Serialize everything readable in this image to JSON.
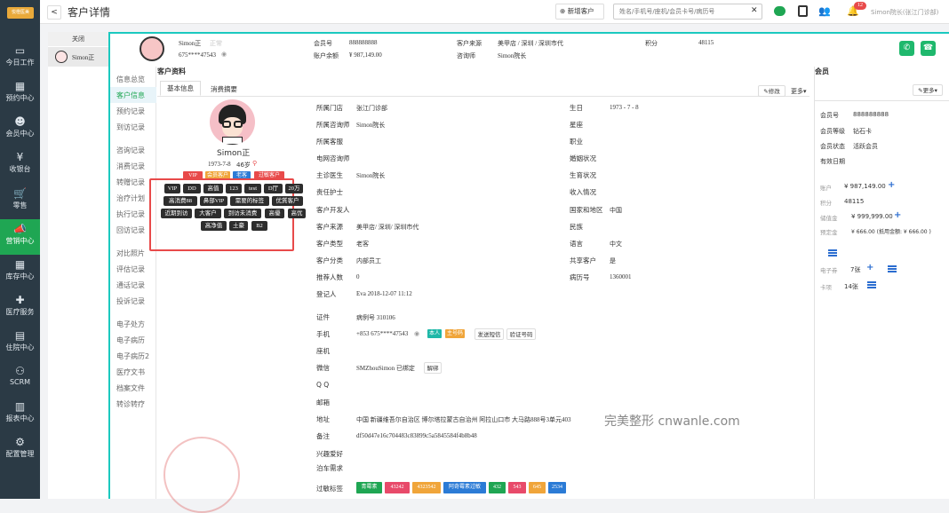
{
  "app": {
    "logo_text": "悦橙医美"
  },
  "sidenav": [
    {
      "label": "今日工作",
      "icon": "monitor-icon"
    },
    {
      "label": "预约中心",
      "icon": "calendar-icon"
    },
    {
      "label": "会员中心",
      "icon": "users-icon"
    },
    {
      "label": "收银台",
      "icon": "yen-icon"
    },
    {
      "label": "零售",
      "icon": "cart-icon"
    },
    {
      "label": "营销中心",
      "icon": "megaphone-icon"
    },
    {
      "label": "库存中心",
      "icon": "grid-icon"
    },
    {
      "label": "医疗服务",
      "icon": "medkit-icon"
    },
    {
      "label": "住院中心",
      "icon": "clipboard-icon"
    },
    {
      "label": "SCRM",
      "icon": "network-icon"
    },
    {
      "label": "报表中心",
      "icon": "chart-icon"
    },
    {
      "label": "配置管理",
      "icon": "gear-icon"
    }
  ],
  "topbar": {
    "back": "<",
    "title": "客户详情",
    "new_customer": "新增客户",
    "search_placeholder": "姓名/手机号/座机/会员卡号/病历号",
    "badge": "12",
    "user": "Simon院长(张江门诊部)"
  },
  "tabs": {
    "close": "关闭",
    "current": "Simon正"
  },
  "header": {
    "name": "Simon正",
    "name_tag": "正常",
    "phone": "675****47543",
    "member_no_label": "会员号",
    "member_no": "888888888",
    "balance_label": "账户余额",
    "balance": "¥ 987,149.00",
    "source_label": "客户来源",
    "source": "美甲店 / 深圳 / 深圳市代",
    "consultant_label": "咨询师",
    "consultant": "Simon院长",
    "points_label": "积分",
    "points": "48115"
  },
  "leftmenu": [
    {
      "label": "信息总览"
    },
    {
      "label": "客户信息"
    },
    {
      "label": "预约记录"
    },
    {
      "label": "到访记录"
    },
    {
      "label": "咨询记录"
    },
    {
      "label": "消费记录"
    },
    {
      "label": "转赠记录"
    },
    {
      "label": "治疗计划"
    },
    {
      "label": "执行记录"
    },
    {
      "label": "回访记录"
    },
    {
      "label": "对比照片"
    },
    {
      "label": "评估记录"
    },
    {
      "label": "通话记录"
    },
    {
      "label": "投诉记录"
    },
    {
      "label": "电子处方"
    },
    {
      "label": "电子病历"
    },
    {
      "label": "电子病历2"
    },
    {
      "label": "医疗文书"
    },
    {
      "label": "档案文件"
    },
    {
      "label": "转诊转疗"
    }
  ],
  "profile": {
    "section_title": "客户资料",
    "tab_basic": "基本信息",
    "tab_consume": "消费摘要",
    "edit": "修改",
    "more": "更多",
    "name": "Simon正",
    "birth": "1973-7-8",
    "age": "46岁",
    "status_tags": [
      {
        "text": "VIP",
        "color": "#e84a4a"
      },
      {
        "text": "会员客户",
        "color": "#f0a53a"
      },
      {
        "text": "老客",
        "color": "#2b7bd6"
      },
      {
        "text": "过敏客户",
        "color": "#e84a4a"
      }
    ],
    "dark_tags": [
      [
        "VIP",
        "DD",
        "高值",
        "123",
        "test",
        "D厅",
        "20万"
      ],
      [
        "高消费88",
        "鼻部VIP",
        "需要的标签",
        "优質客户"
      ],
      [
        "近期到访",
        "大客户",
        "到访未消费",
        "高優",
        "高优"
      ],
      [
        "高净值",
        "土豪",
        "B2"
      ]
    ]
  },
  "fields_left": [
    {
      "label": "所属门店",
      "value": "张江门诊部"
    },
    {
      "label": "所属咨询师",
      "value": "Simon院长"
    },
    {
      "label": "所属客服",
      "value": ""
    },
    {
      "label": "电网咨询师",
      "value": ""
    },
    {
      "label": "主诊医生",
      "value": "Simon院长"
    },
    {
      "label": "责任护士",
      "value": ""
    },
    {
      "label": "客户开发人",
      "value": ""
    },
    {
      "label": "客户来源",
      "value": "美甲店/ 深圳/ 深圳市代"
    },
    {
      "label": "客户类型",
      "value": "老客"
    },
    {
      "label": "客户分类",
      "value": "内部员工"
    },
    {
      "label": "推荐人数",
      "value": "0"
    },
    {
      "label": "登记人",
      "value": "Eva    2018-12-07 11:12"
    }
  ],
  "fields_right": [
    {
      "label": "生日",
      "value": "1973 - 7 - 8"
    },
    {
      "label": "星座",
      "value": ""
    },
    {
      "label": "职业",
      "value": ""
    },
    {
      "label": "婚姻状况",
      "value": ""
    },
    {
      "label": "生育状况",
      "value": ""
    },
    {
      "label": "收入情况",
      "value": ""
    },
    {
      "label": "国家和地区",
      "value": "中国"
    },
    {
      "label": "民族",
      "value": ""
    },
    {
      "label": "语言",
      "value": "中文"
    },
    {
      "label": "共享客户",
      "value": "是"
    },
    {
      "label": "病历号",
      "value": "1360001"
    }
  ],
  "fields_bottom": [
    {
      "label": "证件",
      "value": "病例号    310106"
    },
    {
      "label": "手机",
      "value": "+853  675****47543"
    },
    {
      "label": "座机",
      "value": ""
    },
    {
      "label": "微信",
      "value": "SMZhouSimon  已绑定"
    },
    {
      "label": "Q Q",
      "value": ""
    },
    {
      "label": "邮箱",
      "value": ""
    },
    {
      "label": "地址",
      "value": "中国 新疆维吾尔自治区 博尔塔拉蒙古自治州 阿拉山口市 大马路888号3单元403"
    },
    {
      "label": "备注",
      "value": "df50d47e16c704483c83899c5a5845584f4b8b48"
    },
    {
      "label": "兴趣爱好",
      "value": ""
    },
    {
      "label": "泊车需求",
      "value": ""
    },
    {
      "label": "过敏标签",
      "value": ""
    }
  ],
  "phone_actions": {
    "tag1": "本人",
    "tag2": "主号码",
    "sms": "发送短信",
    "verify": "验证号码"
  },
  "wechat_action": "解绑",
  "allergy_tags": [
    {
      "text": "青霉素",
      "color": "#1fa653"
    },
    {
      "text": "43242",
      "color": "#e84a6a"
    },
    {
      "text": "4323542",
      "color": "#f0a53a"
    },
    {
      "text": "阿奇霉素过敏",
      "color": "#2b7bd6"
    },
    {
      "text": "432",
      "color": "#1fa653"
    },
    {
      "text": "543",
      "color": "#e84a6a"
    },
    {
      "text": "645",
      "color": "#f0a53a"
    },
    {
      "text": "2534",
      "color": "#2b7bd6"
    }
  ],
  "watermark": "完美整形 cnwanle.com",
  "member": {
    "title": "会员",
    "more": "更多",
    "rows": [
      {
        "label": "会员号",
        "value": "888888888"
      },
      {
        "label": "会员等级",
        "value": "钻石卡"
      },
      {
        "label": "会员状态",
        "value": "活跃会员"
      },
      {
        "label": "有效日期",
        "value": ""
      }
    ],
    "account_label": "账户",
    "account": "¥ 987,149.00",
    "points_label": "积分",
    "points": "48115",
    "stored_label": "储值金",
    "stored": "¥ 999,999.00",
    "prestored_label": "预定金",
    "prestored": "¥ 666.00 (抵用金额: ¥ 666.00 )",
    "coupon_label": "电子券",
    "coupon": "7张",
    "card_label": "卡项",
    "card": "14张"
  }
}
